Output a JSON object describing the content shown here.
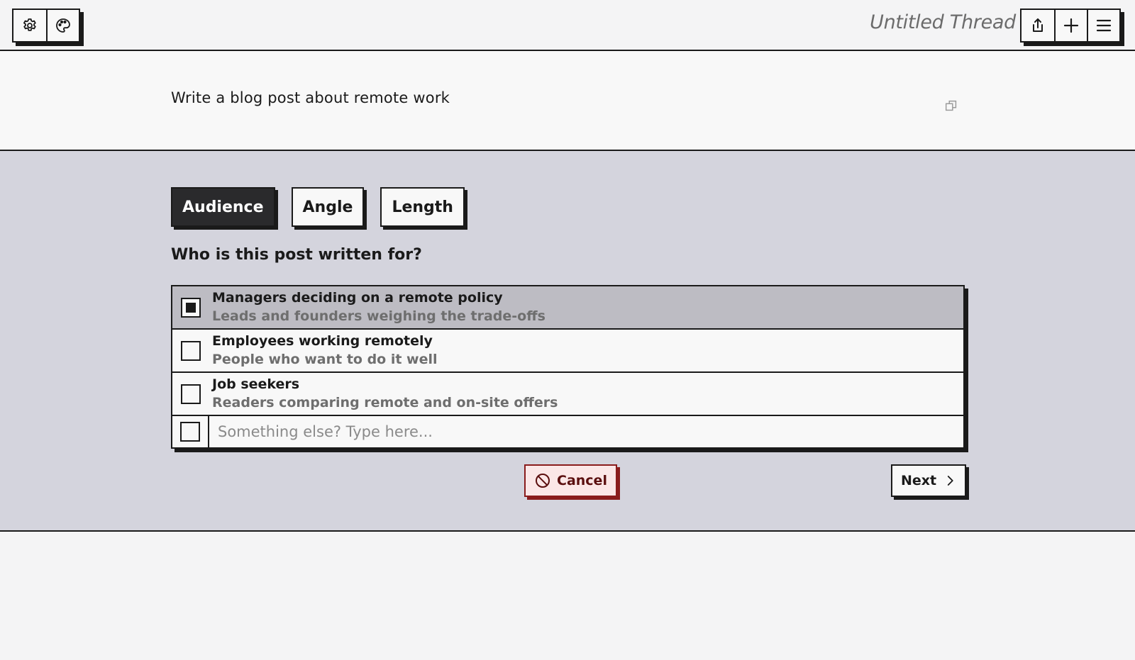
{
  "header": {
    "left_icons": [
      "gear-icon",
      "palette-icon"
    ],
    "thread_title": "Untitled Thread",
    "right_icons": [
      "share-icon",
      "plus-icon",
      "menu-icon"
    ]
  },
  "message": {
    "text": "Write a blog post about remote work",
    "copy_icon": "copy-icon"
  },
  "panel": {
    "tabs": [
      {
        "label": "Audience",
        "active": true
      },
      {
        "label": "Angle",
        "active": false
      },
      {
        "label": "Length",
        "active": false
      }
    ],
    "question": "Who is this post written for?",
    "options": [
      {
        "label": "Managers deciding on a remote policy",
        "description": "Leads and founders weighing the trade-offs",
        "checked": true
      },
      {
        "label": "Employees working remotely",
        "description": "People who want to do it well",
        "checked": false
      },
      {
        "label": "Job seekers",
        "description": "Readers comparing remote and on-site offers",
        "checked": false
      }
    ],
    "other": {
      "placeholder": "Something else? Type here...",
      "value": "",
      "checked": false
    },
    "cancel_label": "Cancel",
    "next_label": "Next"
  },
  "colors": {
    "panel_bg": "#d4d4dd",
    "selected_row": "#bdbcc3",
    "cancel_border": "#8a1c1c",
    "cancel_bg": "#fbe7e7"
  }
}
